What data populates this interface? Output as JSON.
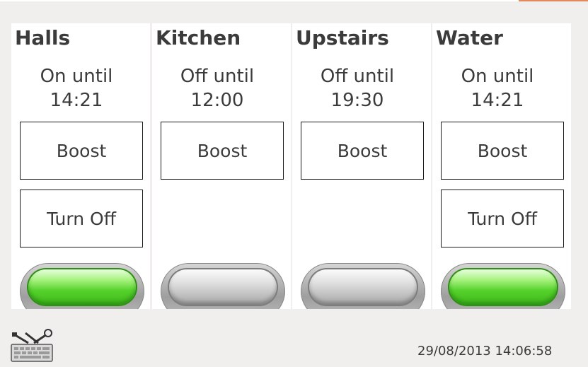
{
  "zones": [
    {
      "name": "Halls",
      "status_line1": "On until",
      "status_line2": "14:21",
      "boost_label": "Boost",
      "off_label": "Turn Off",
      "state": "on"
    },
    {
      "name": "Kitchen",
      "status_line1": "Off until",
      "status_line2": "12:00",
      "boost_label": "Boost",
      "state": "off"
    },
    {
      "name": "Upstairs",
      "status_line1": "Off until",
      "status_line2": "19:30",
      "boost_label": "Boost",
      "state": "off"
    },
    {
      "name": "Water",
      "status_line1": "On until",
      "status_line2": "14:21",
      "boost_label": "Boost",
      "off_label": "Turn Off",
      "state": "on"
    }
  ],
  "footer": {
    "settings_icon": "keyboard-tools-icon",
    "datetime": "29/08/2013 14:06:58"
  },
  "colors": {
    "background": "#f0efed",
    "panel": "#ffffff",
    "led_on": "#55d12b",
    "led_off": "#c2c2c2",
    "text": "#3b3b3b"
  }
}
